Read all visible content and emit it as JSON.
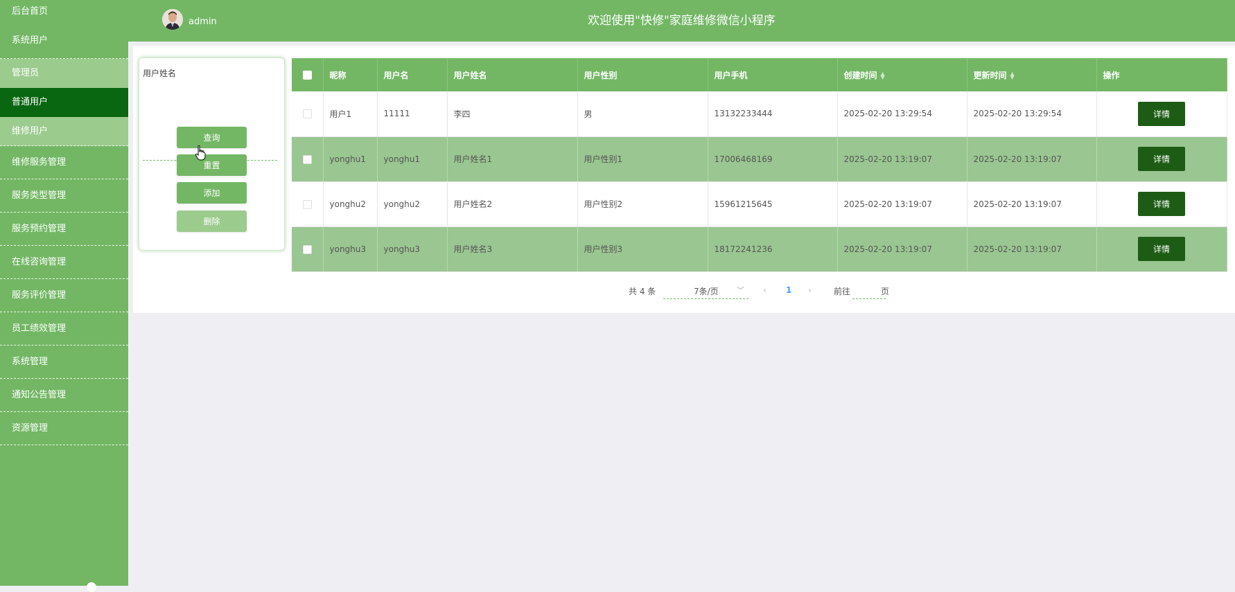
{
  "sidebar": {
    "items": [
      {
        "label": "后台首页"
      },
      {
        "label": "系统用户"
      },
      {
        "label": "管理员"
      },
      {
        "label": "普通用户"
      },
      {
        "label": "维修用户"
      },
      {
        "label": "维修服务管理"
      },
      {
        "label": "服务类型管理"
      },
      {
        "label": "服务预约管理"
      },
      {
        "label": "在线咨询管理"
      },
      {
        "label": "服务评价管理"
      },
      {
        "label": "员工绩效管理"
      },
      {
        "label": "系统管理"
      },
      {
        "label": "通知公告管理"
      },
      {
        "label": "资源管理"
      }
    ]
  },
  "header": {
    "user": "admin",
    "title": "欢迎使用\"快修\"家庭维修微信小程序"
  },
  "search": {
    "label": "用户姓名",
    "value": "",
    "buttons": {
      "query": "查询",
      "reset": "重置",
      "add": "添加",
      "delete": "删除"
    }
  },
  "table": {
    "columns": [
      "昵称",
      "用户名",
      "用户姓名",
      "用户性别",
      "用户手机",
      "创建时间",
      "更新时间",
      "操作"
    ],
    "rows": [
      {
        "nickname": "用户1",
        "username": "11111",
        "realname": "李四",
        "gender": "男",
        "phone": "13132233444",
        "created": "2025-02-20 13:29:54",
        "updated": "2025-02-20 13:29:54",
        "action": "详情"
      },
      {
        "nickname": "yonghu1",
        "username": "yonghu1",
        "realname": "用户姓名1",
        "gender": "用户性别1",
        "phone": "17006468169",
        "created": "2025-02-20 13:19:07",
        "updated": "2025-02-20 13:19:07",
        "action": "详情"
      },
      {
        "nickname": "yonghu2",
        "username": "yonghu2",
        "realname": "用户姓名2",
        "gender": "用户性别2",
        "phone": "15961215645",
        "created": "2025-02-20 13:19:07",
        "updated": "2025-02-20 13:19:07",
        "action": "详情"
      },
      {
        "nickname": "yonghu3",
        "username": "yonghu3",
        "realname": "用户姓名3",
        "gender": "用户性别3",
        "phone": "18172241236",
        "created": "2025-02-20 13:19:07",
        "updated": "2025-02-20 13:19:07",
        "action": "详情"
      }
    ]
  },
  "pagination": {
    "total": "共 4 条",
    "page_size": "7条/页",
    "current_page": "1",
    "goto_label": "前往",
    "goto_suffix": "页"
  },
  "colors": {
    "primary": "#73b765",
    "active": "#0a6711",
    "button_dark": "#1d5c14",
    "row_alt": "#9ac691"
  }
}
